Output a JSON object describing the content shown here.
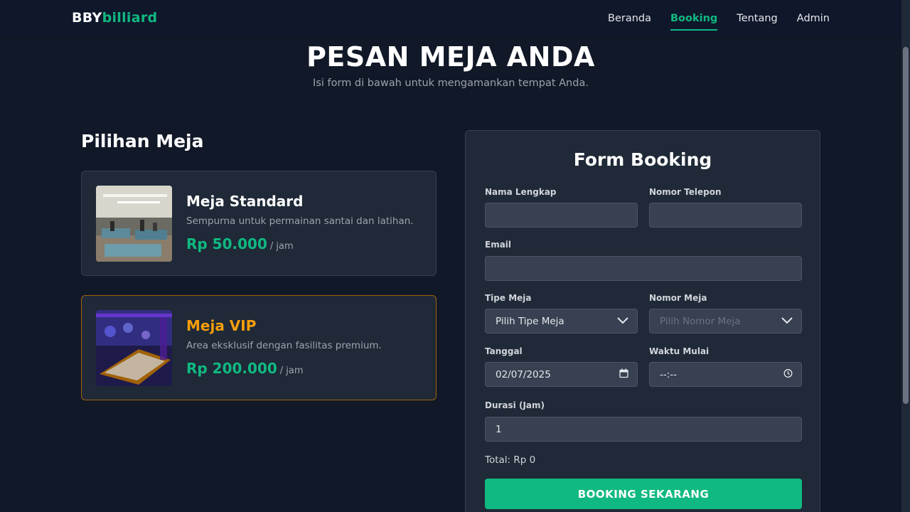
{
  "header": {
    "logo_part1": "BBY",
    "logo_part2": "billiard",
    "nav": [
      {
        "label": "Beranda"
      },
      {
        "label": "Booking"
      },
      {
        "label": "Tentang"
      },
      {
        "label": "Admin"
      }
    ]
  },
  "hero": {
    "title": "PESAN MEJA ANDA",
    "subtitle": "Isi form di bawah untuk mengamankan tempat Anda."
  },
  "tables": {
    "title": "Pilihan Meja",
    "items": [
      {
        "name": "Meja Standard",
        "desc": "Sempurna untuk permainan santai dan latihan.",
        "price": "Rp 50.000",
        "unit": "/ jam"
      },
      {
        "name": "Meja VIP",
        "desc": "Area eksklusif dengan fasilitas premium.",
        "price": "Rp 200.000",
        "unit": "/ jam"
      }
    ]
  },
  "form": {
    "title": "Form Booking",
    "name_label": "Nama Lengkap",
    "name_value": "",
    "phone_label": "Nomor Telepon",
    "phone_value": "",
    "email_label": "Email",
    "email_value": "",
    "type_label": "Tipe Meja",
    "type_value": "Pilih Tipe Meja",
    "number_label": "Nomor Meja",
    "number_placeholder": "Pilih Nomor Meja",
    "date_label": "Tanggal",
    "date_value": "02/07/2025",
    "time_label": "Waktu Mulai",
    "time_value": "--:--",
    "duration_label": "Durasi (Jam)",
    "duration_value": "1",
    "total": "Total: Rp 0",
    "submit": "BOOKING SEKARANG"
  },
  "colors": {
    "background": "#111827",
    "accent": "#10b981",
    "vip": "#f59e0b"
  },
  "icons": [
    "chevron-down-icon",
    "calendar-icon",
    "clock-icon"
  ]
}
